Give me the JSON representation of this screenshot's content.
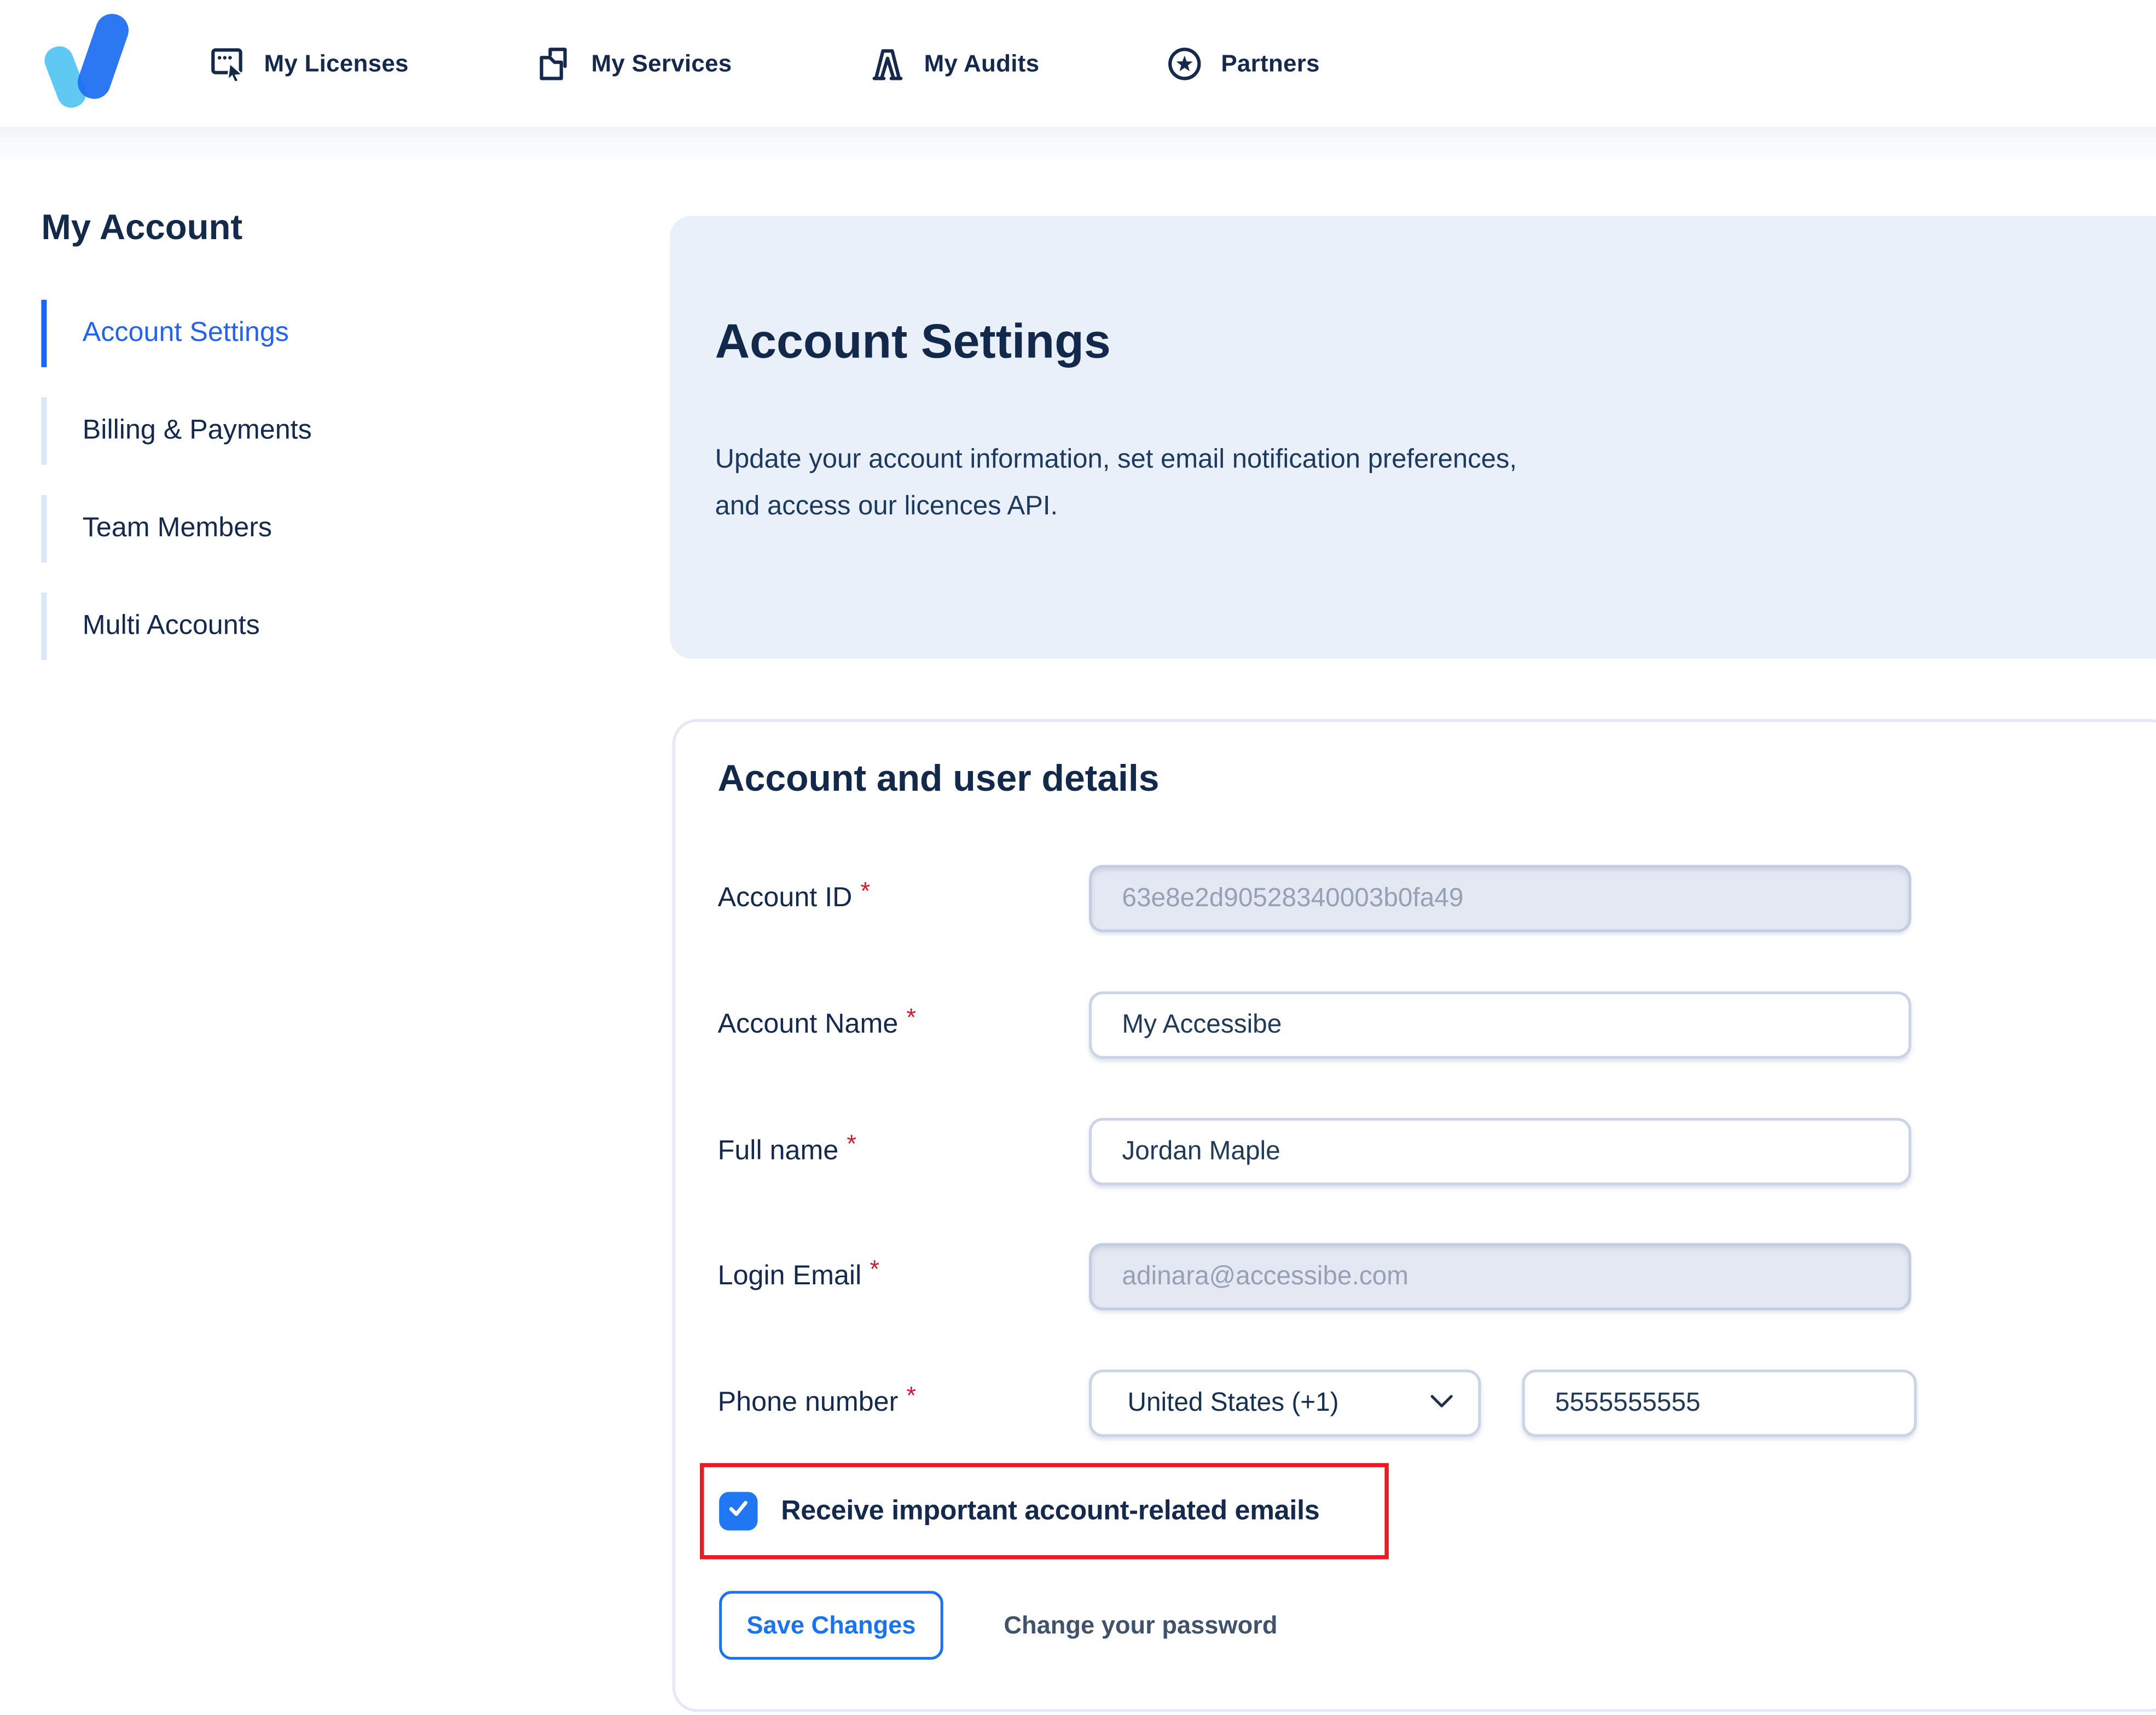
{
  "header": {
    "nav": [
      {
        "label": "My Licenses",
        "icon": "chat-cursor-icon"
      },
      {
        "label": "My Services",
        "icon": "folder-doc-icon"
      },
      {
        "label": "My Audits",
        "icon": "audit-icon"
      },
      {
        "label": "Partners",
        "icon": "star-circle-icon"
      }
    ]
  },
  "sidebar": {
    "title": "My Account",
    "items": [
      {
        "label": "Account Settings",
        "active": true
      },
      {
        "label": "Billing & Payments",
        "active": false
      },
      {
        "label": "Team Members",
        "active": false
      },
      {
        "label": "Multi Accounts",
        "active": false
      }
    ]
  },
  "banner": {
    "title": "Account Settings",
    "description_line1": "Update your account information, set email notification preferences,",
    "description_line2": "and access our licences API."
  },
  "card": {
    "title": "Account and user details",
    "fields": [
      {
        "label": "Account ID",
        "required": "*",
        "value": "63e8e2d90528340003b0fa49",
        "disabled": true
      },
      {
        "label": "Account Name",
        "required": "*",
        "value": "My Accessibe",
        "disabled": false
      },
      {
        "label": "Full name",
        "required": "*",
        "value": "Jordan Maple",
        "disabled": false
      },
      {
        "label": "Login Email",
        "required": "*",
        "value": "adinara@accessibe.com",
        "disabled": true
      }
    ],
    "phone": {
      "label": "Phone number",
      "required": "*",
      "country_selected": "United States (+1)",
      "number": "5555555555"
    },
    "checkbox": {
      "label": "Receive important account-related emails",
      "checked": true
    },
    "actions": {
      "save": "Save Changes",
      "change_password": "Change your password"
    }
  },
  "colors": {
    "accent_blue": "#1a74f0",
    "checkbox_blue": "#2176f3",
    "highlight_red": "#e81c24",
    "navy": "#14294b",
    "banner_bg": "#e9f0fa",
    "active_link_blue": "#2563eb"
  }
}
